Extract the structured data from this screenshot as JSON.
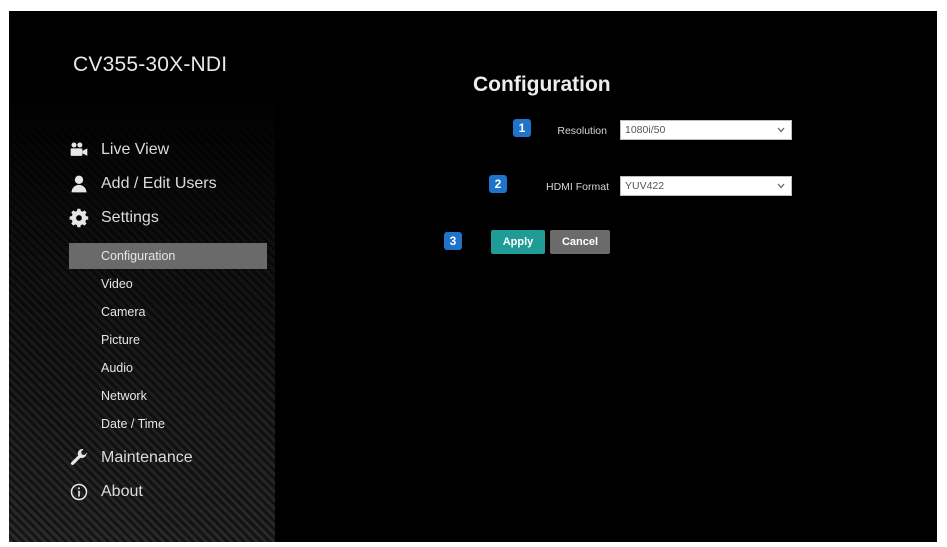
{
  "device": {
    "name": "CV355-30X-NDI"
  },
  "nav": {
    "live_view": "Live View",
    "add_edit_users": "Add / Edit Users",
    "settings": "Settings",
    "maintenance": "Maintenance",
    "about": "About"
  },
  "settings_items": [
    "Configuration",
    "Video",
    "Camera",
    "Picture",
    "Audio",
    "Network",
    "Date / Time"
  ],
  "page": {
    "title": "Configuration"
  },
  "fields": {
    "resolution": {
      "badge": "1",
      "label": "Resolution",
      "value": "1080i/50"
    },
    "hdmi_format": {
      "badge": "2",
      "label": "HDMI Format",
      "value": "YUV422"
    }
  },
  "actions": {
    "badge": "3",
    "apply": "Apply",
    "cancel": "Cancel"
  },
  "colors": {
    "badge": "#1f73c9",
    "apply": "#1f9c96",
    "cancel": "#6b6b6b",
    "active_item": "#6a6a6a"
  }
}
